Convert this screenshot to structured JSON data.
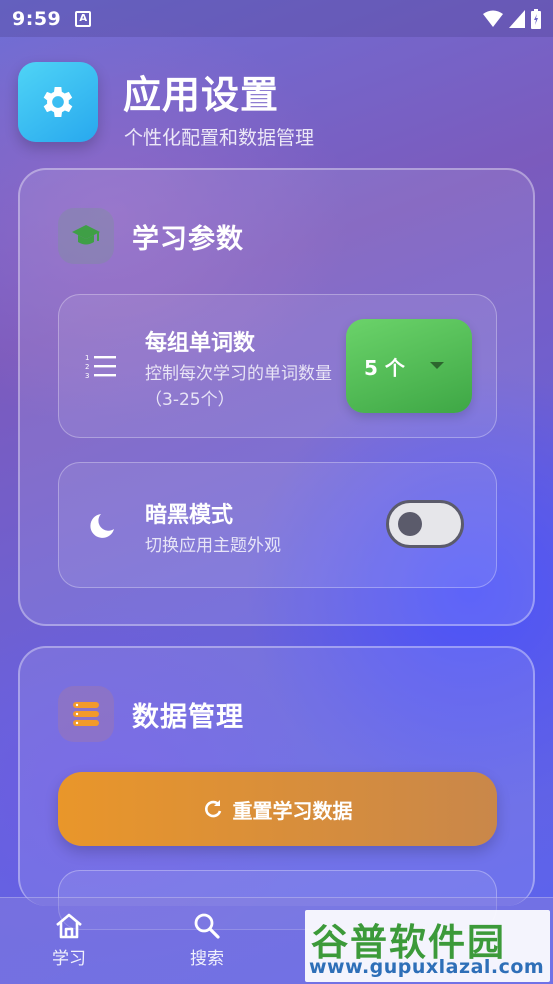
{
  "status_bar": {
    "time": "9:59",
    "notification_letter": "A"
  },
  "header": {
    "title": "应用设置",
    "subtitle": "个性化配置和数据管理",
    "icon": "gear-icon"
  },
  "learning_card": {
    "title": "学习参数",
    "icon": "graduation-cap-icon",
    "words_per_group": {
      "title": "每组单词数",
      "desc": "控制每次学习的单词数量（3-25个）",
      "icon": "numbered-list-icon",
      "value": "5 个"
    },
    "dark_mode": {
      "title": "暗黑模式",
      "desc": "切换应用主题外观",
      "icon": "moon-icon",
      "enabled": false
    }
  },
  "data_card": {
    "title": "数据管理",
    "icon": "database-icon",
    "reset_button": "重置学习数据",
    "reset_icon": "refresh-icon"
  },
  "bottom_nav": [
    {
      "label": "学习",
      "icon": "home-icon"
    },
    {
      "label": "搜索",
      "icon": "search-icon"
    }
  ],
  "watermark": {
    "title": "谷普软件园",
    "url": "www.gupuxlazal.com"
  },
  "colors": {
    "accent_green": "#4caf50",
    "accent_orange": "#e6952c",
    "icon_blue": "#2fb4f0"
  }
}
